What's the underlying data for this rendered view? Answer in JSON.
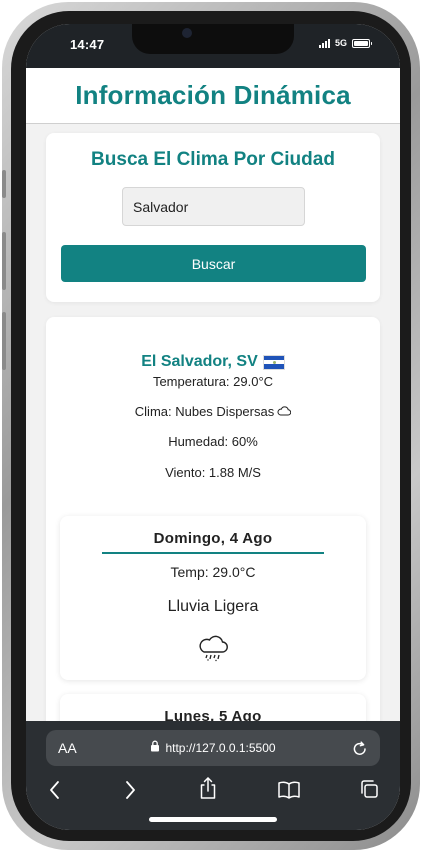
{
  "status_bar": {
    "time": "14:47",
    "network": "5G",
    "icons": [
      "signal-icon",
      "battery-icon"
    ]
  },
  "page": {
    "title": "Información Dinámica"
  },
  "search": {
    "heading": "Busca El Clima Por Ciudad",
    "input_value": "Salvador",
    "button_label": "Buscar"
  },
  "weather": {
    "city": "El Salvador, SV",
    "flag_icon": "el-salvador-flag-icon",
    "temperature": "Temperatura: 29.0°C",
    "condition": "Clima: Nubes Dispersas",
    "condition_icon": "cloud-icon",
    "humidity": "Humedad: 60%",
    "wind": "Viento: 1.88 M/S"
  },
  "forecast": [
    {
      "day": "Domingo, 4 Ago",
      "temp": "Temp: 29.0°C",
      "description": "Lluvia Ligera",
      "icon": "rain-cloud-icon"
    },
    {
      "day": "Lunes, 5 Ago"
    }
  ],
  "browser": {
    "text_size_label": "AA",
    "url": "http://127.0.0.1:5500",
    "icons": [
      "lock-icon",
      "reload-icon",
      "back-icon",
      "forward-icon",
      "share-icon",
      "bookmarks-icon",
      "tabs-icon"
    ]
  },
  "colors": {
    "accent": "#128282",
    "background": "#f2f2f2",
    "card": "#ffffff",
    "browser_bar": "#2b2f33"
  }
}
